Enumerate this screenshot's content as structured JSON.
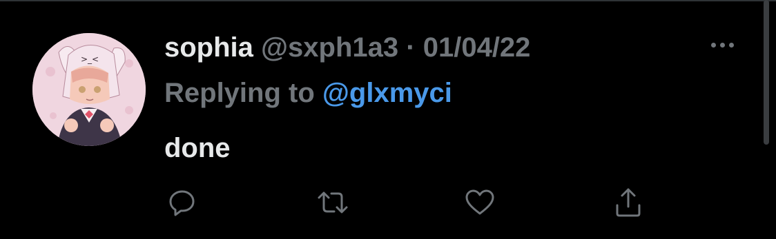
{
  "tweet": {
    "author": {
      "display_name": "sophia",
      "handle": "@sxph1a3"
    },
    "separator": "·",
    "date": "01/04/22",
    "replying_prefix": "Replying to",
    "replying_to": "@glxmyci",
    "text": "done"
  },
  "actions": [
    {
      "name": "reply",
      "icon": "reply-icon"
    },
    {
      "name": "retweet",
      "icon": "retweet-icon"
    },
    {
      "name": "like",
      "icon": "heart-icon"
    },
    {
      "name": "share",
      "icon": "share-icon"
    }
  ],
  "colors": {
    "background": "#000000",
    "primary_text": "#e7e9ea",
    "secondary_text": "#71767b",
    "accent": "#4a99e9",
    "divider": "#2f3336"
  }
}
